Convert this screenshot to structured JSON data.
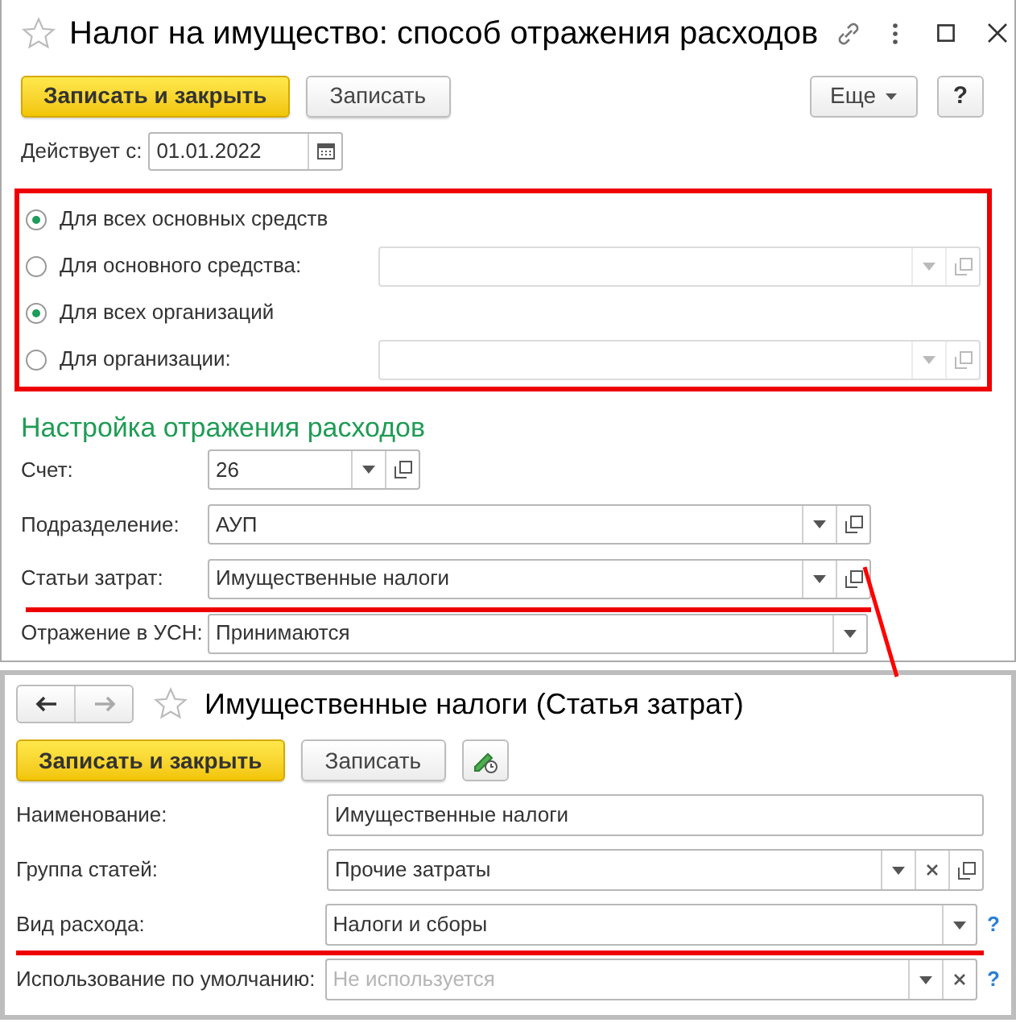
{
  "main_window": {
    "title": "Налог на имущество: способ отражения расходов",
    "buttons": [
      {
        "label": "Записать и закрыть",
        "kind": "primary"
      },
      {
        "label": "Записать",
        "kind": "normal"
      }
    ],
    "more_button": "Еще",
    "help_button": "?",
    "date": {
      "label": "Действует с:",
      "value": "01.01.2022"
    },
    "radios": [
      {
        "label": "Для всех основных средств",
        "selected": true,
        "has_field": false
      },
      {
        "label": "Для основного средства:",
        "selected": false,
        "has_field": true
      },
      {
        "label": "Для всех организаций",
        "selected": true,
        "has_field": false
      },
      {
        "label": "Для организации:",
        "selected": false,
        "has_field": true
      }
    ],
    "section_title": "Настройка отражения расходов",
    "fields": [
      {
        "label": "Счет:",
        "value": "26",
        "buttons": [
          {
            "kind": "dropdown"
          },
          {
            "kind": "open"
          }
        ],
        "underlined": false
      },
      {
        "label": "Подразделение:",
        "value": "АУП",
        "buttons": [
          {
            "kind": "dropdown"
          },
          {
            "kind": "open"
          }
        ],
        "underlined": false
      },
      {
        "label": "Статьи затрат:",
        "value": "Имущественные налоги",
        "buttons": [
          {
            "kind": "dropdown"
          },
          {
            "kind": "open"
          }
        ],
        "underlined": true
      },
      {
        "label": "Отражение в УСН:",
        "value": "Принимаются",
        "buttons": [
          {
            "kind": "dropdown"
          }
        ],
        "underlined": false
      }
    ]
  },
  "sub_window": {
    "title": "Имущественные налоги (Статья затрат)",
    "buttons": [
      {
        "label": "Записать и закрыть",
        "kind": "primary"
      },
      {
        "label": "Записать",
        "kind": "normal"
      }
    ],
    "fields": [
      {
        "label": "Наименование:",
        "value": "Имущественные налоги",
        "underlined": false
      },
      {
        "label": "Группа статей:",
        "value": "Прочие затраты",
        "buttons": [
          {
            "kind": "dropdown"
          },
          {
            "kind": "clear"
          },
          {
            "kind": "open"
          }
        ],
        "underlined": false
      },
      {
        "label": "Вид расхода:",
        "value": "Налоги и сборы",
        "buttons": [
          {
            "kind": "dropdown"
          }
        ],
        "help": "?",
        "underlined": true
      },
      {
        "label": "Использование по умолчанию:",
        "placeholder": "Не используется",
        "buttons": [
          {
            "kind": "dropdown"
          },
          {
            "kind": "clear"
          }
        ],
        "help": "?",
        "underlined": false
      }
    ]
  }
}
